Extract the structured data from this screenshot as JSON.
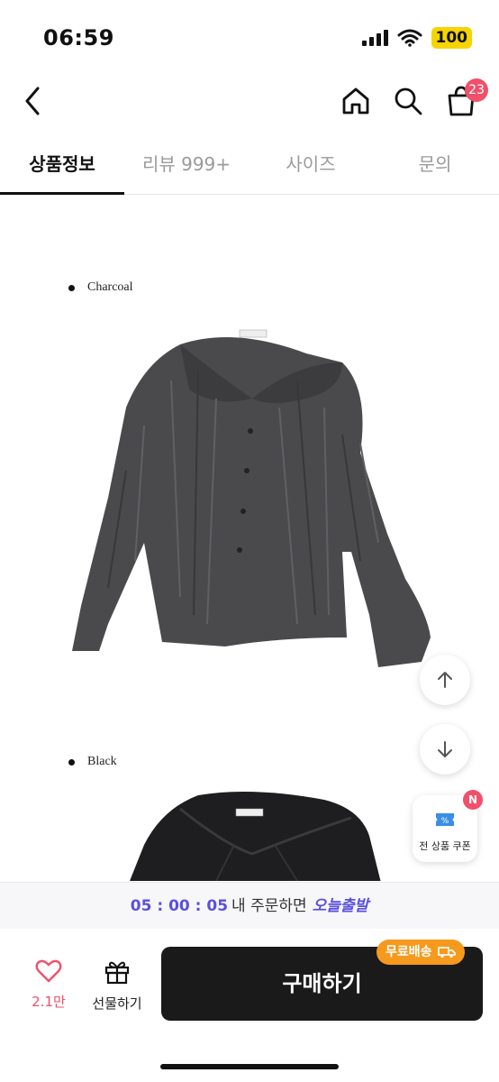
{
  "status": {
    "time": "06:59",
    "battery": "100"
  },
  "nav": {
    "cart_count": "23",
    "icons": [
      "back-icon",
      "home-icon",
      "search-icon",
      "cart-icon"
    ]
  },
  "tabs": [
    {
      "label": "상품정보",
      "active": true
    },
    {
      "label": "리뷰 999+",
      "active": false
    },
    {
      "label": "사이즈",
      "active": false
    },
    {
      "label": "문의",
      "active": false
    }
  ],
  "content": {
    "colors": [
      "Charcoal",
      "Black"
    ],
    "garment_colors": {
      "charcoal": "#4a4a4c",
      "black": "#1e1e20"
    }
  },
  "floating": {
    "coupon_label": "전 상품 쿠폰",
    "coupon_badge": "N"
  },
  "delivery": {
    "timer": "05 : 00 : 05",
    "text": "내 주문하면",
    "today": "오늘출발"
  },
  "bottom": {
    "like_count": "2.1만",
    "gift_label": "선물하기",
    "buy_label": "구매하기",
    "free_ship_label": "무료배송"
  },
  "colors": {
    "accent": "#5b4fe0",
    "badge": "#f0506a",
    "ship": "#f59a1d",
    "buy_bg": "#1a1a1a"
  }
}
